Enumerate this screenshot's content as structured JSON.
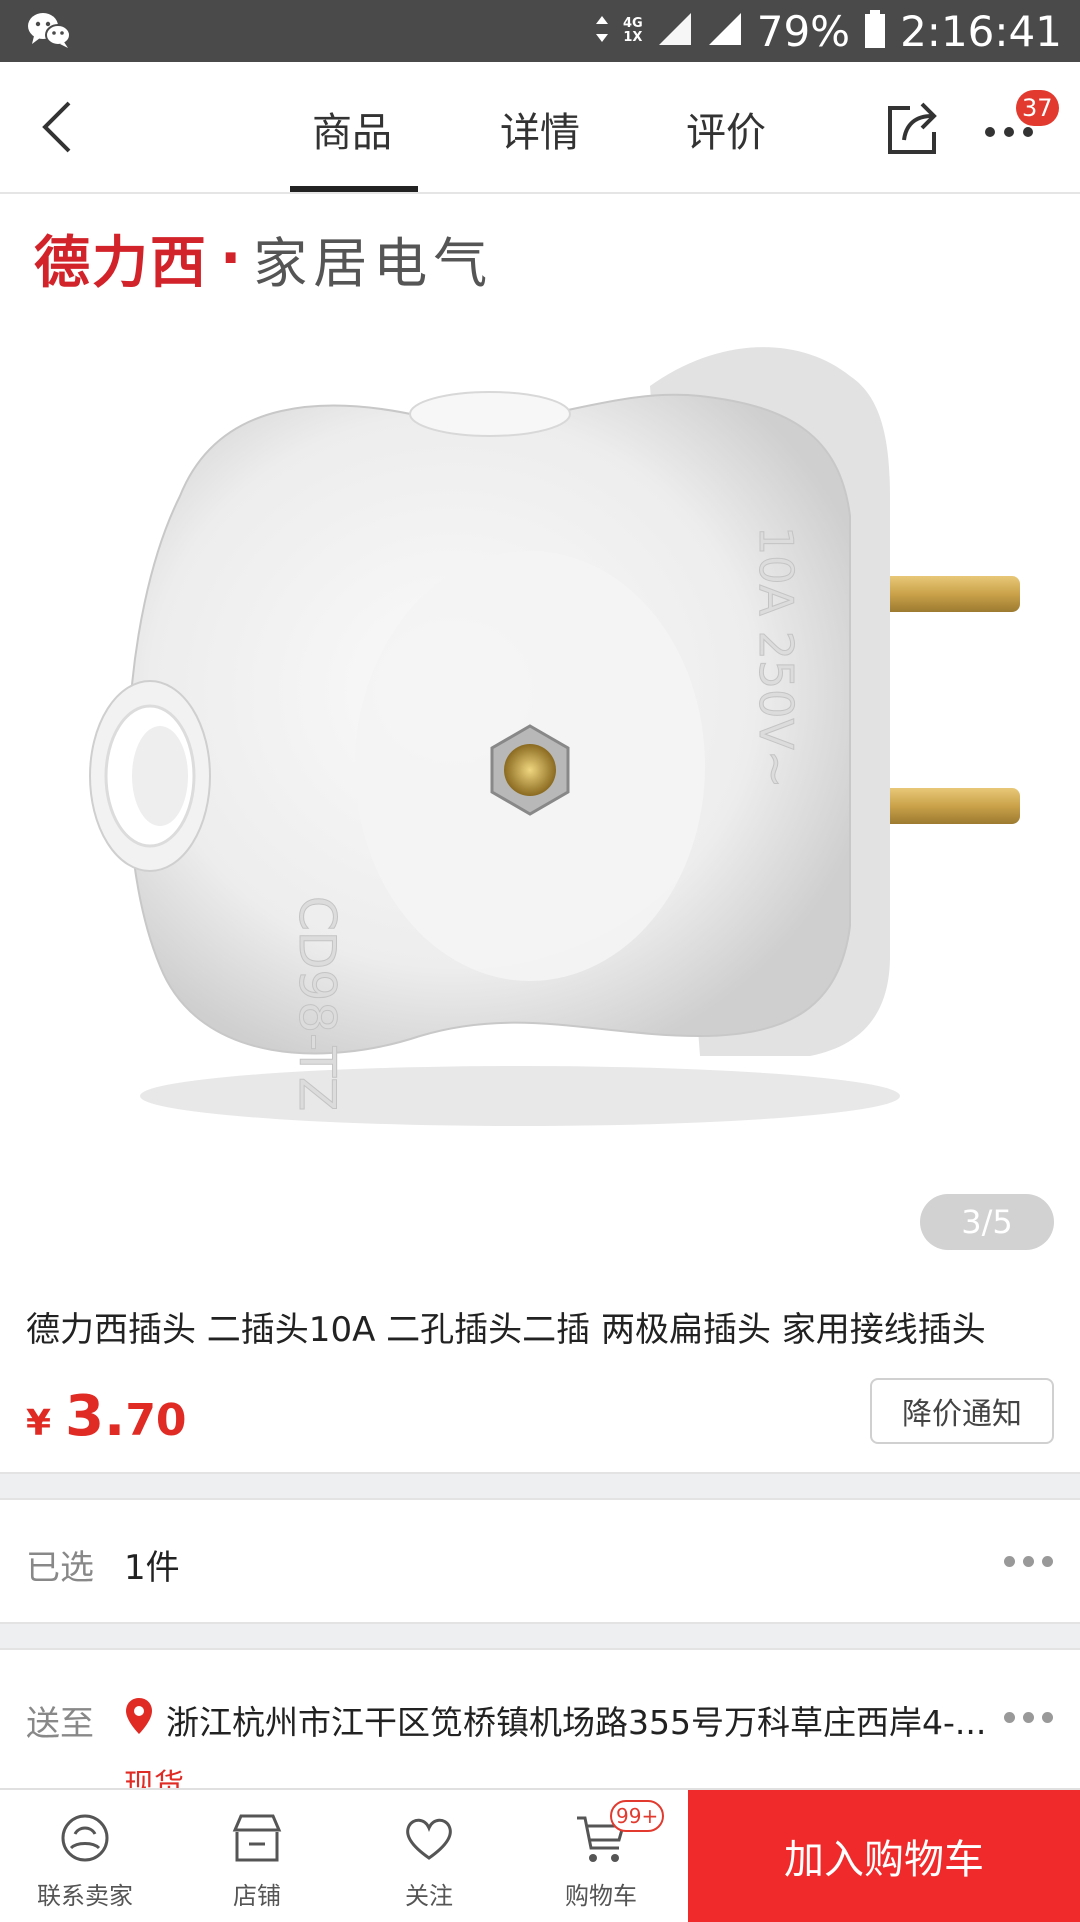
{
  "status_bar": {
    "battery": "79%",
    "time": "2:16:41",
    "net_top": "4G",
    "net_bottom": "1X",
    "icons": [
      "wechat-icon",
      "data-arrows-icon",
      "signal-icon",
      "signal-icon",
      "battery-icon"
    ]
  },
  "nav": {
    "tabs": [
      {
        "label": "商品",
        "active": true
      },
      {
        "label": "详情",
        "active": false
      },
      {
        "label": "评价",
        "active": false
      }
    ],
    "message_badge": "37"
  },
  "product": {
    "brand_name": "德力西",
    "brand_dot": "·",
    "brand_tagline": "家居电气",
    "image_counter": "3/5",
    "title": "德力西插头 二插头10A 二孔插头二插 两极扁插头 家用接线插头",
    "price_currency": "¥",
    "price_int": "3.",
    "price_dec": "70",
    "notify_label": "降价通知"
  },
  "selection": {
    "label": "已选",
    "value": "1件"
  },
  "delivery": {
    "label": "送至",
    "address": "浙江杭州市江干区笕桥镇机场路355号万科草庄西岸4-...",
    "stock": "现货"
  },
  "bottom_bar": {
    "contact": "联系卖家",
    "shop": "店铺",
    "follow": "关注",
    "cart": "购物车",
    "cart_badge": "99+",
    "add_to_cart": "加入购物车"
  },
  "colors": {
    "accent_red": "#e02a24",
    "cart_button": "#f02a2a",
    "status_bar": "#4a4a4a"
  }
}
